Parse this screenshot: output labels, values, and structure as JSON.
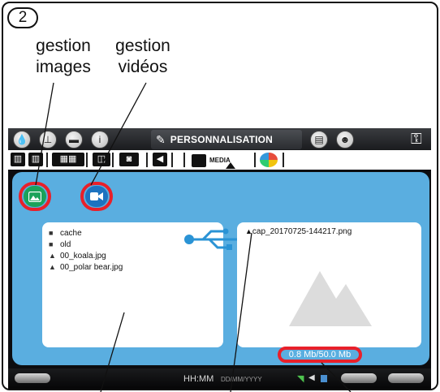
{
  "step": "2",
  "callouts": {
    "images": "gestion\nimages",
    "videos": "gestion\nvidéos"
  },
  "topbar": {
    "active_tab": "PERSONNALISATION"
  },
  "subbar": {
    "active_tab": "MEDIA"
  },
  "file_list": [
    {
      "icon": "folder-icon",
      "name": "cache"
    },
    {
      "icon": "folder-icon",
      "name": "old"
    },
    {
      "icon": "image-file-icon",
      "name": "00_koala.jpg"
    },
    {
      "icon": "image-file-icon",
      "name": "00_polar bear.jpg"
    }
  ],
  "preview": {
    "filename": "cap_20170725-144217.png"
  },
  "storage": "0.8 Mb/50.0 Mb",
  "status_bar": {
    "time": "HH:MM",
    "date": "DD/MM/YYYY"
  },
  "colors": {
    "panel_blue": "#5aaee0",
    "highlight_red": "#e8202a",
    "images_green": "#1ba25a",
    "videos_blue": "#1d73c0"
  }
}
